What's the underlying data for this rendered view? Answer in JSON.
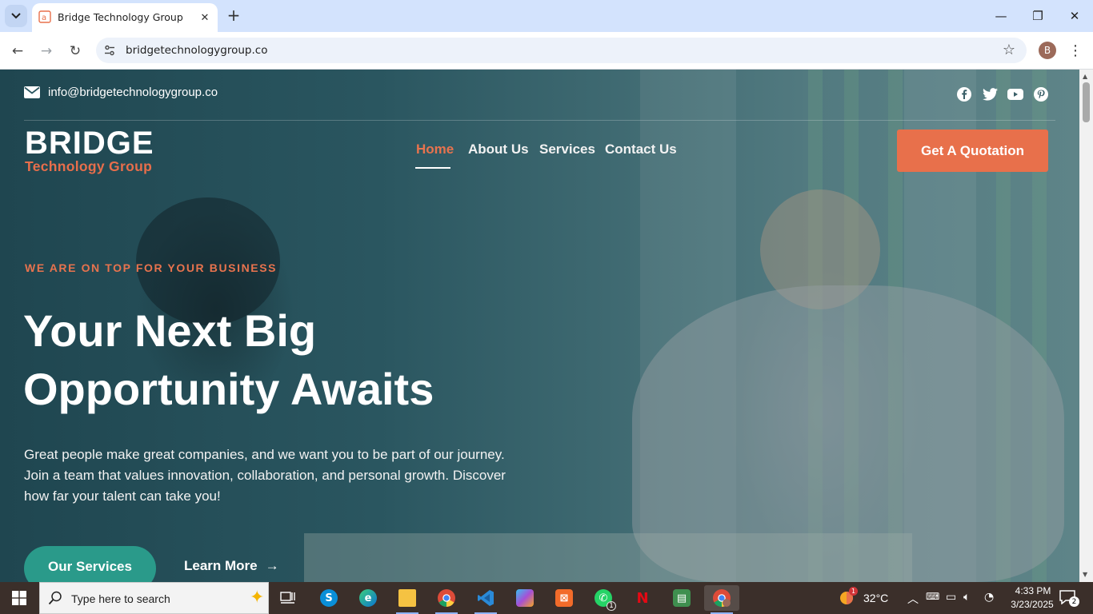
{
  "browser": {
    "tab_title": "Bridge Technology Group",
    "tab_close": "✕",
    "new_tab": "+",
    "url": "bridgetechnologygroup.co",
    "profile_initial": "B",
    "window_min": "—",
    "window_max": "❐",
    "window_close": "✕",
    "back": "←",
    "forward": "→",
    "reload": "↻",
    "bookmark": "☆",
    "menu": "⋮"
  },
  "topbar": {
    "email": "info@bridgetechnologygroup.co",
    "social_icons": [
      "facebook-icon",
      "twitter-icon",
      "youtube-icon",
      "pinterest-icon"
    ]
  },
  "header": {
    "logo_main": "BRIDGE",
    "logo_sub": "Technology Group",
    "nav": [
      "Home",
      "About Us",
      "Services",
      "Contact Us"
    ],
    "active_nav": "Home",
    "cta": "Get A Quotation"
  },
  "hero": {
    "eyebrow": "WE ARE ON TOP FOR YOUR BUSINESS",
    "title_line1": "Your Next Big",
    "title_line2": "Opportunity Awaits",
    "description": "Great people make great companies, and we want you to be part of our journey. Join a team that values innovation, collaboration, and personal growth. Discover how far your talent can take you!",
    "primary_button": "Our Services",
    "secondary_button": "Learn More",
    "secondary_arrow": "→"
  },
  "taskbar": {
    "search_placeholder": "Type here to search",
    "apps": [
      "task-view",
      "skype",
      "edge",
      "file-explorer",
      "chrome",
      "vscode",
      "copilot",
      "xampp",
      "whatsapp",
      "netflix",
      "notes",
      "chrome-profile"
    ],
    "whatsapp_badge": "1",
    "weather_temp": "32°C",
    "weather_badge": "1",
    "time": "4:33 PM",
    "date": "3/23/2025",
    "notification_count": "2"
  },
  "colors": {
    "accent": "#e8704b",
    "teal_button": "#2a9a8a",
    "hero_overlay": "#2a5660"
  }
}
